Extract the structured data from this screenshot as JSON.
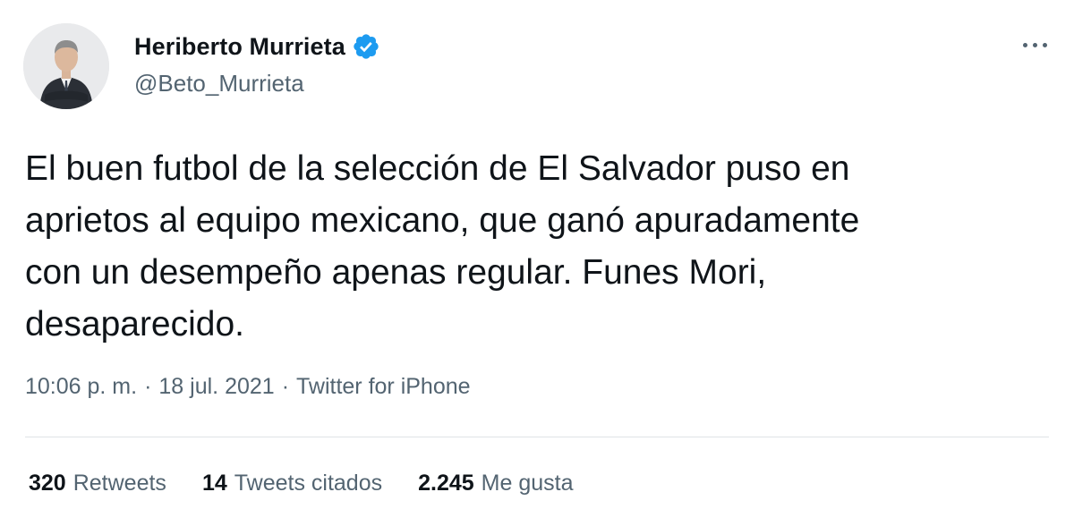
{
  "author": {
    "display_name": "Heriberto Murrieta",
    "handle": "@Beto_Murrieta",
    "avatar_icon": "profile-photo-icon",
    "verified_icon": "verified-badge-icon"
  },
  "menu": {
    "more_icon": "more-horizontal-icon"
  },
  "tweet": {
    "text": "El buen futbol de la selección de El Salvador puso en\naprietos al equipo mexicano, que ganó apuradamente\ncon un desempeño apenas regular. Funes Mori,\ndesaparecido.",
    "time": "10:06 p. m.",
    "separator": "·",
    "date": "18 jul. 2021",
    "source": "Twitter for iPhone"
  },
  "stats": {
    "retweets": {
      "count": "320",
      "label": "Retweets"
    },
    "quotes": {
      "count": "14",
      "label": "Tweets citados"
    },
    "likes": {
      "count": "2.245",
      "label": "Me gusta"
    }
  },
  "colors": {
    "text_primary": "#0f1419",
    "text_secondary": "#536471",
    "verified_blue": "#1d9bf0",
    "divider": "#dfe3e6"
  }
}
